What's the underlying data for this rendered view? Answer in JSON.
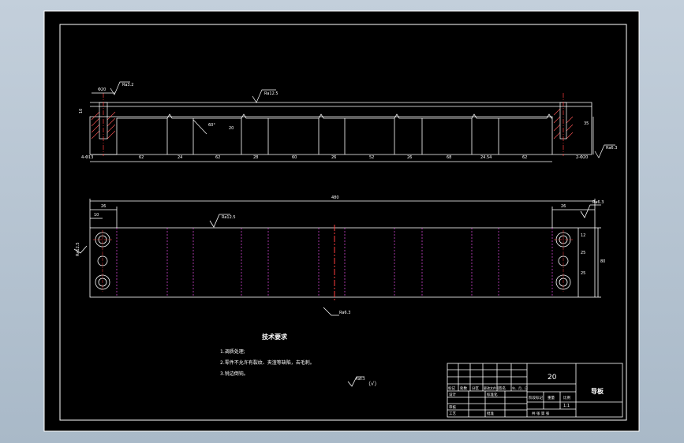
{
  "top_view": {
    "roughness_main": "Ra12.5",
    "roughness_left_hole": "Ra3.2",
    "roughness_right": "Ra6.3",
    "dim_hole_dia": "Φ20",
    "dim_left_height": "10",
    "dim_slot_depth": "20",
    "dim_slot_angle": "60°",
    "dim_right_height": "35",
    "dim_left_holes": "4-Φ13",
    "dim_right_holes": "2-Φ20",
    "segments": [
      "62",
      "24",
      "62",
      "28",
      "60",
      "26",
      "52",
      "26",
      "68",
      "24.54",
      "62"
    ]
  },
  "bottom_view": {
    "dim_overall_length": "480",
    "dim_left_edge": "26",
    "dim_left_hole": "10",
    "dim_right_edge": "26",
    "roughness_top": "Ra12.5",
    "roughness_left": "Ra12.5",
    "roughness_right": "Ra6.3",
    "roughness_bottom": "Ra6.3",
    "dim_v1": "12",
    "dim_v2": "25",
    "dim_v3": "25",
    "dim_total_height": "80"
  },
  "notes": {
    "title": "技术要求",
    "items": [
      "1.调质处理;",
      "2.零件不允许有裂纹、夹渣等缺陷，去毛刺。",
      "3.锐边倒钝。"
    ]
  },
  "rough_other": {
    "symbol_label": "Ra6.3",
    "paren": "（√）"
  },
  "title_block": {
    "number": "20",
    "part_name": "导板",
    "rev_row": [
      "标记",
      "处数",
      "分区",
      "更改文件号",
      "签名",
      "年、月、日"
    ],
    "design": "设计",
    "standardization": "标准化",
    "stage_labels": [
      "阶段标记",
      "重量",
      "比例"
    ],
    "check": "审核",
    "process": "工艺",
    "approve": "批准",
    "sheet": "共  张  第  张",
    "scale": "1:1"
  }
}
